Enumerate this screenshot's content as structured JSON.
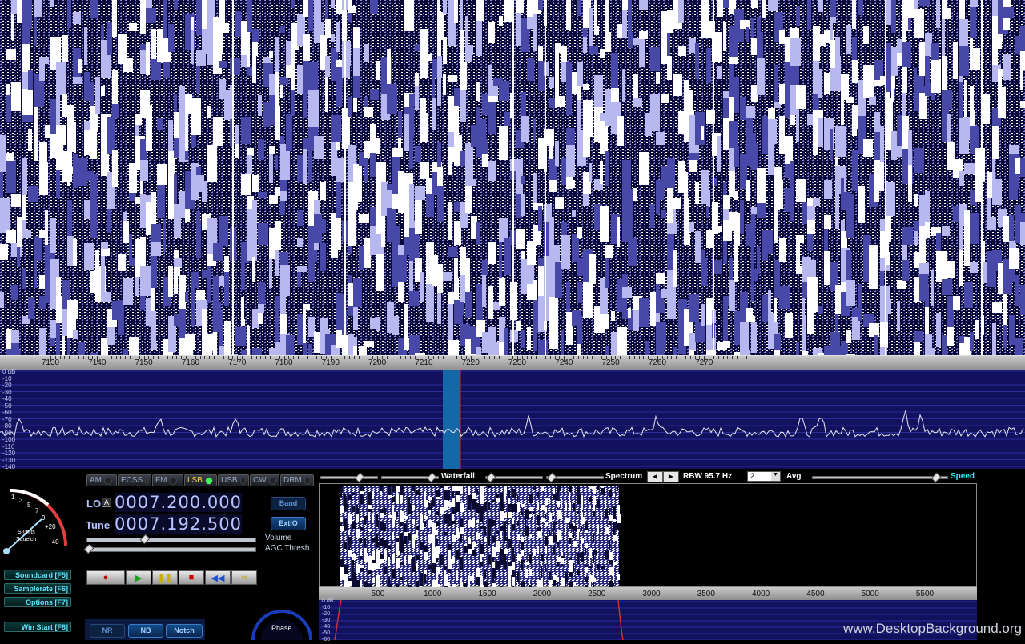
{
  "waterfall_main": {
    "x_ticks": [
      "7130",
      "7140",
      "7150",
      "7160",
      "7170",
      "7180",
      "7190",
      "7200",
      "7210",
      "7220",
      "7230",
      "7240",
      "7250",
      "7260",
      "7270"
    ]
  },
  "spectrum_main": {
    "y_labels": [
      "0 dB",
      "-10",
      "-20",
      "-30",
      "-40",
      "-50",
      "-60",
      "-70",
      "-80",
      "-90",
      "-100",
      "-110",
      "-120",
      "-130",
      "-140"
    ]
  },
  "modes": [
    {
      "label": "AM",
      "active": false
    },
    {
      "label": "ECSS",
      "active": false
    },
    {
      "label": "FM",
      "active": false
    },
    {
      "label": "LSB",
      "active": true
    },
    {
      "label": "USB",
      "active": false
    },
    {
      "label": "CW",
      "active": false
    },
    {
      "label": "DRM",
      "active": false
    }
  ],
  "smeter": {
    "scale": [
      "1",
      "3",
      "5",
      "7",
      "9",
      "+20",
      "+40"
    ],
    "label1": "S-units",
    "label2": "Squelch"
  },
  "lo": {
    "label": "LO",
    "badge": "A",
    "value": "0007.200.000"
  },
  "tune": {
    "label": "Tune",
    "value": "0007.192.500"
  },
  "buttons": {
    "band": "Band",
    "extio": "ExtIO"
  },
  "sliders": {
    "volume": "Volume",
    "agc": "AGC Thresh."
  },
  "side_buttons": [
    {
      "label": "Soundcard [F5]"
    },
    {
      "label": "Samplerate [F6]"
    },
    {
      "label": "Options [F7]"
    },
    {
      "label": "Win Start [F8]"
    }
  ],
  "transport": [
    "●",
    "▶",
    "❚❚",
    "■",
    "◀◀",
    "∞"
  ],
  "dsp": {
    "nr": "NR",
    "nb": "NB",
    "notch": "Notch"
  },
  "phase_label": "Phase",
  "top_panel": {
    "waterfall": "Waterfall",
    "spectrum": "Spectrum",
    "rbw": "RBW 95.7 Hz",
    "avg_value": "2",
    "avg": "Avg",
    "speed": "Speed"
  },
  "small_scale": [
    "500",
    "1000",
    "1500",
    "2000",
    "2500",
    "3000",
    "3500",
    "4000",
    "4500",
    "5000",
    "5500"
  ],
  "small_y": [
    "0 dB",
    "-10",
    "-20",
    "-30",
    "-40",
    "-50",
    "-60"
  ],
  "watermark": "www.DesktopBackground.org"
}
